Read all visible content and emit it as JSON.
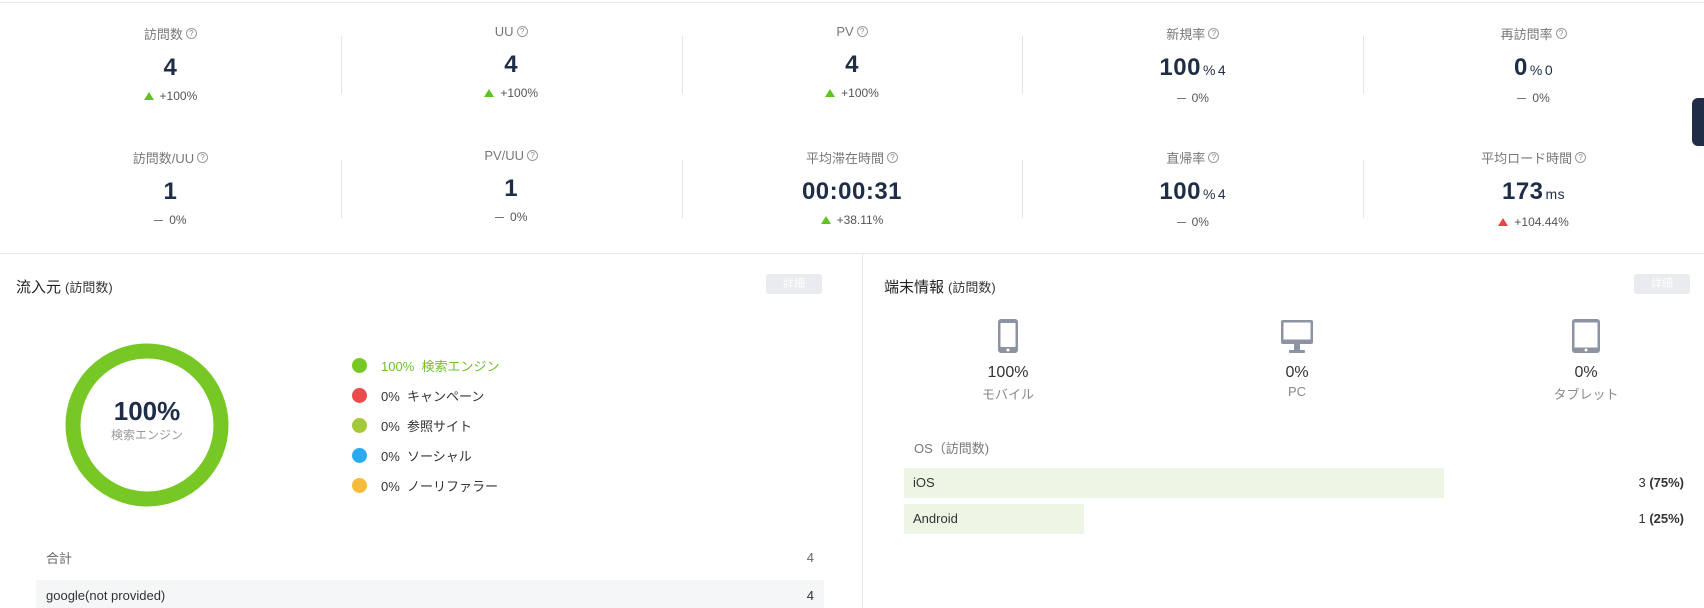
{
  "kpis": [
    {
      "label": "訪問数",
      "value": "4",
      "unit": "",
      "sub": "",
      "change": "+100%",
      "trend": "up"
    },
    {
      "label": "UU",
      "value": "4",
      "unit": "",
      "sub": "",
      "change": "+100%",
      "trend": "up"
    },
    {
      "label": "PV",
      "value": "4",
      "unit": "",
      "sub": "",
      "change": "+100%",
      "trend": "up"
    },
    {
      "label": "新規率",
      "value": "100",
      "unit": "%",
      "sub": "4",
      "change": "0%",
      "trend": "flat"
    },
    {
      "label": "再訪問率",
      "value": "0",
      "unit": "%",
      "sub": "0",
      "change": "0%",
      "trend": "flat"
    },
    {
      "label": "訪問数/UU",
      "value": "1",
      "unit": "",
      "sub": "",
      "change": "0%",
      "trend": "flat"
    },
    {
      "label": "PV/UU",
      "value": "1",
      "unit": "",
      "sub": "",
      "change": "0%",
      "trend": "flat"
    },
    {
      "label": "平均滞在時間",
      "value": "00:00:31",
      "unit": "",
      "sub": "",
      "change": "+38.11%",
      "trend": "up"
    },
    {
      "label": "直帰率",
      "value": "100",
      "unit": "%",
      "sub": "4",
      "change": "0%",
      "trend": "flat"
    },
    {
      "label": "平均ロード時間",
      "value": "173",
      "unit": "ms",
      "sub": "",
      "change": "+104.44%",
      "trend": "up-red"
    }
  ],
  "help_glyph": "?",
  "traffic": {
    "title": "流入元",
    "subtitle": "(訪問数)",
    "detail_label": "詳細",
    "donut_pct": "100%",
    "donut_label": "検索エンジン",
    "donut_fraction": 1.0,
    "donut_color": "#77c824",
    "legend": [
      {
        "label": "100%  検索エンジン",
        "color": "#77c824",
        "active": true
      },
      {
        "label": "0%  キャンペーン",
        "color": "#e84c4c",
        "active": false
      },
      {
        "label": "0%  参照サイト",
        "color": "#a3c83a",
        "active": false
      },
      {
        "label": "0%  ソーシャル",
        "color": "#2aaaf0",
        "active": false
      },
      {
        "label": "0%  ノーリファラー",
        "color": "#f7bb3a",
        "active": false
      }
    ],
    "total_label": "合計",
    "total_value": "4",
    "rows": [
      {
        "name": "google(not provided)",
        "value": "4"
      }
    ]
  },
  "device": {
    "title": "端末情報",
    "subtitle": "(訪問数)",
    "detail_label": "詳細",
    "items": [
      {
        "pct": "100%",
        "label": "モバイル",
        "icon": "smartphone-icon"
      },
      {
        "pct": "0%",
        "label": "PC",
        "icon": "monitor-icon"
      },
      {
        "pct": "0%",
        "label": "タブレット",
        "icon": "tablet-icon"
      }
    ],
    "os_title": "OS（訪問数)",
    "os": [
      {
        "name": "iOS",
        "count": "3",
        "pct": "(75%)",
        "fraction": 0.75
      },
      {
        "name": "Android",
        "count": "1",
        "pct": "(25%)",
        "fraction": 0.25
      }
    ]
  }
}
